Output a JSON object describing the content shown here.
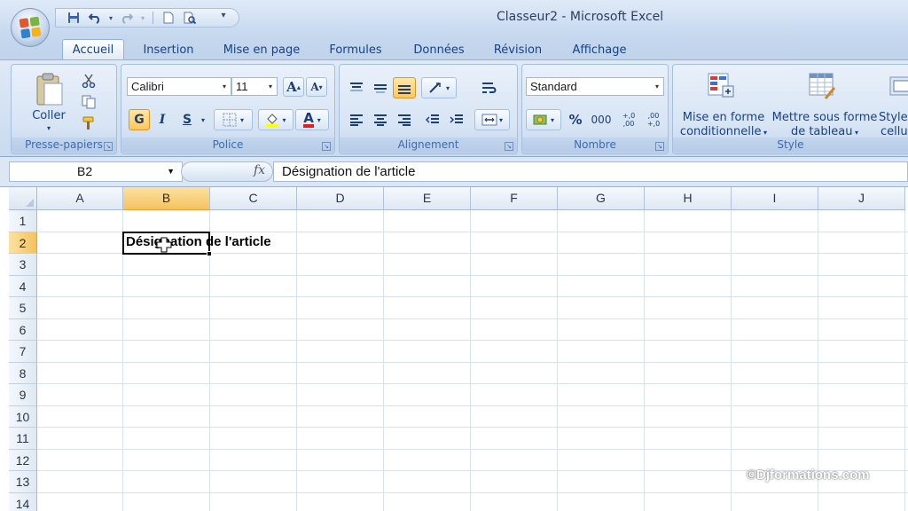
{
  "window": {
    "title": "Classeur2 - Microsoft Excel"
  },
  "quick_access": {
    "icons": [
      "save-icon",
      "undo-icon",
      "redo-icon",
      "new-document-icon",
      "print-preview-icon",
      "customize-icon"
    ]
  },
  "tabs": [
    {
      "label": "Accueil",
      "active": true
    },
    {
      "label": "Insertion"
    },
    {
      "label": "Mise en page"
    },
    {
      "label": "Formules"
    },
    {
      "label": "Données"
    },
    {
      "label": "Révision"
    },
    {
      "label": "Affichage"
    }
  ],
  "ribbon": {
    "clipboard": {
      "label": "Presse-papiers",
      "paste_label": "Coller"
    },
    "font": {
      "label": "Police",
      "font_name": "Calibri",
      "font_size": "11",
      "bold": "G",
      "italic": "I",
      "underline": "S",
      "font_color_label": "A",
      "grow_label": "A",
      "shrink_label": "A"
    },
    "alignment": {
      "label": "Alignement"
    },
    "number": {
      "label": "Nombre",
      "format": "Standard",
      "percent": "%",
      "thousands": "000",
      "inc_decimal": "+,0 ,00",
      "dec_decimal": ",00 +,0"
    },
    "style": {
      "label": "Style",
      "conditional_line1": "Mise en forme",
      "conditional_line2": "conditionnelle",
      "table_line1": "Mettre sous forme",
      "table_line2": "de tableau",
      "cell_line1": "Styles de",
      "cell_line2": "cellules"
    }
  },
  "formula_bar": {
    "name_box": "B2",
    "fx": "fx",
    "content": "Désignation de l'article"
  },
  "sheet": {
    "columns": [
      "A",
      "B",
      "C",
      "D",
      "E",
      "F",
      "G",
      "H",
      "I",
      "J"
    ],
    "rows": [
      "1",
      "2",
      "3",
      "4",
      "5",
      "6",
      "7",
      "8",
      "9",
      "10",
      "11",
      "12",
      "13",
      "14"
    ],
    "selected_column": "B",
    "selected_row": "2",
    "cell_b2": "Désignation de l'article"
  },
  "watermark": "©Djformations.com",
  "colors": {
    "ribbon": "#dfe9f6",
    "selection_header": "#f5c25e",
    "grid_line": "#d9e1ec"
  }
}
